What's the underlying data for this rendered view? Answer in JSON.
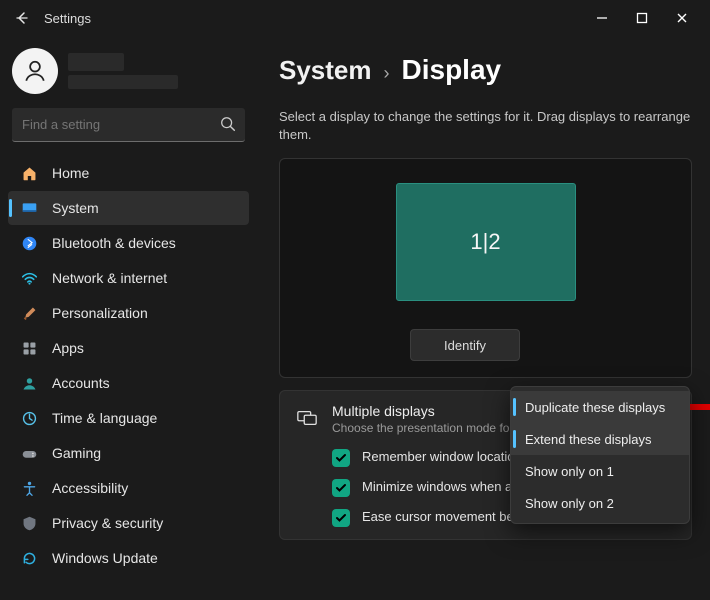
{
  "window": {
    "title": "Settings"
  },
  "search": {
    "placeholder": "Find a setting"
  },
  "sidebar": {
    "items": [
      {
        "label": "Home"
      },
      {
        "label": "System"
      },
      {
        "label": "Bluetooth & devices"
      },
      {
        "label": "Network & internet"
      },
      {
        "label": "Personalization"
      },
      {
        "label": "Apps"
      },
      {
        "label": "Accounts"
      },
      {
        "label": "Time & language"
      },
      {
        "label": "Gaming"
      },
      {
        "label": "Accessibility"
      },
      {
        "label": "Privacy & security"
      },
      {
        "label": "Windows Update"
      }
    ]
  },
  "breadcrumb": {
    "root": "System",
    "leaf": "Display"
  },
  "description": "Select a display to change the settings for it. Drag displays to rearrange them.",
  "monitor_label": "1|2",
  "identify_label": "Identify",
  "multidisplay": {
    "title": "Multiple displays",
    "subtitle": "Choose the presentation mode for y",
    "options": [
      "Remember window locatio…    connection",
      "Minimize windows when a monitor is disconnected",
      "Ease cursor movement between displays"
    ]
  },
  "menu": {
    "items": [
      "Duplicate these displays",
      "Extend these displays",
      "Show only on 1",
      "Show only on 2"
    ]
  }
}
